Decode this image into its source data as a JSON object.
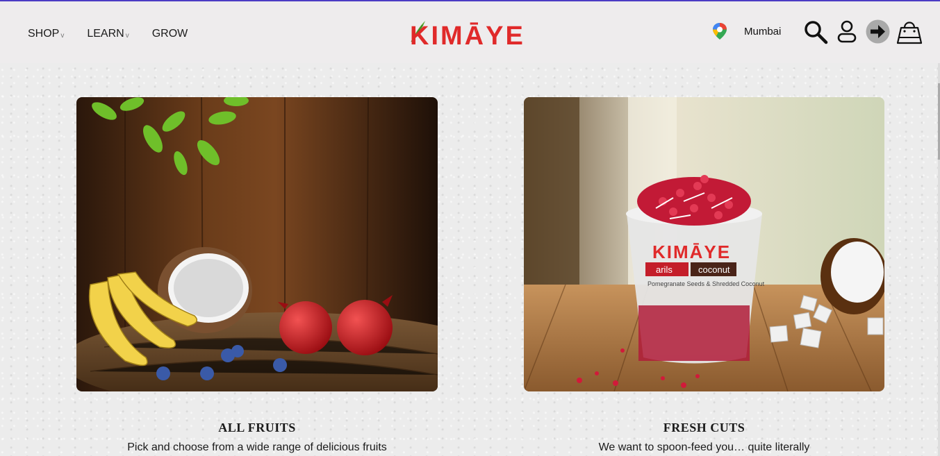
{
  "nav": {
    "shop": "SHOP",
    "learn": "LEARN",
    "grow": "GROW",
    "chevron": "v"
  },
  "brand": {
    "logo_text": "KIMĀYE",
    "logo_color": "#e02a2a",
    "leaf_color": "#5aa832"
  },
  "location": {
    "city": "Mumbai"
  },
  "icons": {
    "location": "map-pin-icon",
    "search": "search-icon",
    "account": "user-icon",
    "login": "arrow-right-circle-icon",
    "cart": "shopping-bag-icon"
  },
  "cards": [
    {
      "title": "ALL FRUITS",
      "description": "Pick and choose from a wide range of delicious fruits",
      "image": "fruits-on-wooden-table"
    },
    {
      "title": "FRESH CUTS",
      "description": "We want to spoon-feed you… quite literally",
      "image": "pomegranate-coconut-cup",
      "cup_brand": "KIMĀYE",
      "cup_labels": [
        "arils",
        "coconut"
      ],
      "cup_subtitle": "Pomegranate Seeds & Shredded Coconut"
    }
  ],
  "colors": {
    "accent_line": "#4b3bc4",
    "header_bg": "#eeeced",
    "page_bg": "#ececec"
  }
}
